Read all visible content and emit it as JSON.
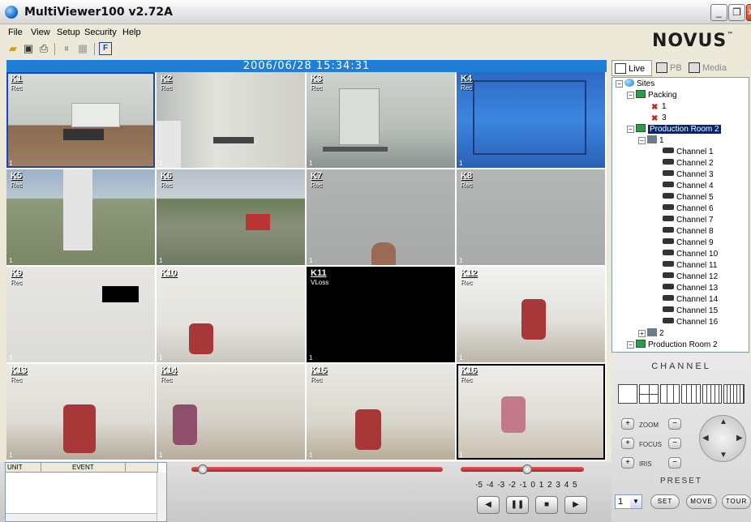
{
  "window": {
    "title": "MultiViewer100 v2.72A"
  },
  "menu": [
    "File",
    "View",
    "Setup",
    "Security",
    "Help"
  ],
  "brand": {
    "logo": "NOVUS",
    "tm": "™"
  },
  "datetime": "2006/06/28  15:34:31",
  "cameras": [
    {
      "label": "K1",
      "status": "Rec",
      "index": "1"
    },
    {
      "label": "K2",
      "status": "Rec",
      "index": "1"
    },
    {
      "label": "K3",
      "status": "Rec",
      "index": "1"
    },
    {
      "label": "K4",
      "status": "Rec",
      "index": "1"
    },
    {
      "label": "K5",
      "status": "Rec",
      "index": "1"
    },
    {
      "label": "K6",
      "status": "Rec",
      "index": "1"
    },
    {
      "label": "K7",
      "status": "Rec",
      "index": "1"
    },
    {
      "label": "K8",
      "status": "Rec",
      "index": "1"
    },
    {
      "label": "K9",
      "status": "Rec",
      "index": "1"
    },
    {
      "label": "K10",
      "status": "",
      "index": "1"
    },
    {
      "label": "K11",
      "status": "VLoss",
      "index": "1"
    },
    {
      "label": "K12",
      "status": "Rec",
      "index": "1"
    },
    {
      "label": "K13",
      "status": "Rec",
      "index": "1"
    },
    {
      "label": "K14",
      "status": "Rec",
      "index": "1"
    },
    {
      "label": "K15",
      "status": "Rec",
      "index": "1"
    },
    {
      "label": "K16",
      "status": "Rec",
      "index": "1"
    }
  ],
  "side_tabs": [
    "Live",
    "PB",
    "Media"
  ],
  "tree": {
    "root": "Sites",
    "site1": "Packing",
    "site1_children": [
      "1",
      "3"
    ],
    "site2": "Production Room 2",
    "dvr1": "1",
    "channels": [
      "Channel 1",
      "Channel 2",
      "Channel 3",
      "Channel 4",
      "Channel 5",
      "Channel 6",
      "Channel 7",
      "Channel 8",
      "Channel 9",
      "Channel 10",
      "Channel 11",
      "Channel 12",
      "Channel 13",
      "Channel 14",
      "Channel 15",
      "Channel 16"
    ],
    "dvr2": "2",
    "site3": "Production Room 2"
  },
  "controls": {
    "channel_title": "CHANNEL",
    "zoom": "ZOOM",
    "focus": "FOCUS",
    "iris": "IRIS",
    "preset_title": "PRESET",
    "preset_value": "1",
    "set": "SET",
    "move": "MOVE",
    "tour": "TOUR"
  },
  "events": {
    "col_unit": "UNIT",
    "col_event": "EVENT"
  },
  "playback": {
    "speed_scale": "-5 -4 -3 -2 -1  0  1  2  3  4  5"
  }
}
